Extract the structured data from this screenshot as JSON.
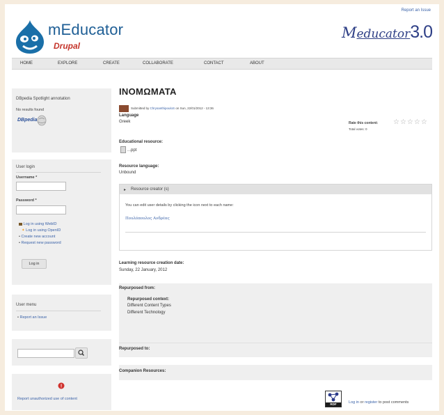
{
  "header": {
    "report_link": "Report an Issue",
    "brand": "mEducator",
    "sub_brand": "Drupal",
    "right_logo_m": "M",
    "right_logo_text": "educator",
    "right_logo_version": "3.0"
  },
  "nav": [
    "HOME",
    "EXPLORE",
    "CREATE",
    "COLLABORATE",
    "CONTACT",
    "ABOUT"
  ],
  "sidebar": {
    "spotlight_title": "DBpedia Spotlight annotation",
    "spotlight_text": "No results found",
    "dbpedia_logo": "DBpedia",
    "login_title": "User login",
    "username_label": "Username *",
    "password_label": "Password *",
    "links": [
      "Log in using WebID",
      "Log in using OpenID",
      "Create new account",
      "Request new password"
    ],
    "login_button": "Log in",
    "user_menu_title": "User menu",
    "user_menu_item": "Report an Issue",
    "search_button_icon": "magnifier-icon",
    "report_text": "Report unauthorized use of content"
  },
  "content": {
    "title": "INOMΩMATA",
    "submitted_prefix": "Submitted by",
    "submitted_user": "ChrysanthipouloS",
    "submitted_date": "on Sun, 22/01/2012 - 13:36",
    "language_label": "Language",
    "language_value": "Greek",
    "rate_label": "Rate this content:",
    "total_votes": "Total votes: 0",
    "stars": "☆☆☆☆☆",
    "edu_resource_label": "Educational resource:",
    "edu_resource_file": "...ppt",
    "resource_language_label": "Resource language:",
    "resource_language_value": "Unbound",
    "creators_header": "Resource creator (s)",
    "creators_hint": "You can edit user details by clicking the icon next to each name:",
    "creator_name": "Πουλόπουλος Ανδρέας",
    "creation_date_label": "Learning resource creation date:",
    "creation_date_value": "Sunday, 22 January, 2012",
    "repurposed_from_label": "Repurposed from:",
    "repurposed_context_label": "Repurposed context:",
    "repurposed_context_items": [
      "Different Content Types",
      "Different Technology"
    ],
    "repurposed_to_label": "Repurposed to:",
    "companion_label": "Companion Resources:",
    "rdf_badge": "RDF",
    "footer_login": "Log in",
    "footer_or": "or",
    "footer_register": "register",
    "footer_suffix": "to post comments"
  }
}
